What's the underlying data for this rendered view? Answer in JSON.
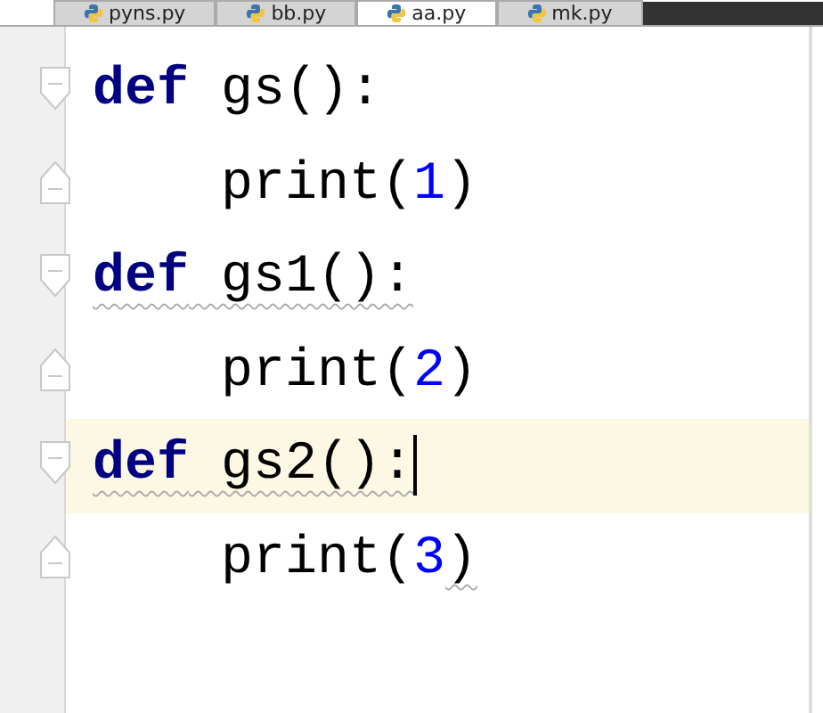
{
  "tabs": [
    {
      "label": "pyns.py",
      "selected": false
    },
    {
      "label": "bb.py",
      "selected": false
    },
    {
      "label": "aa.py",
      "selected": true
    },
    {
      "label": "mk.py",
      "selected": false
    }
  ],
  "lines": [
    {
      "kind": "fold_start",
      "current": false,
      "caret": false,
      "tokens": [
        {
          "kind": "keyword",
          "text": "def",
          "underlined": false
        },
        {
          "kind": "plain",
          "text": " gs():",
          "underlined": false
        }
      ]
    },
    {
      "kind": "fold_end",
      "current": false,
      "caret": false,
      "tokens": [
        {
          "kind": "plain",
          "text": "    print(",
          "underlined": false
        },
        {
          "kind": "number",
          "text": "1",
          "underlined": false
        },
        {
          "kind": "plain",
          "text": ")",
          "underlined": false
        }
      ]
    },
    {
      "kind": "fold_start",
      "current": false,
      "caret": false,
      "tokens": [
        {
          "kind": "keyword",
          "text": "def",
          "underlined": true
        },
        {
          "kind": "plain",
          "text": " gs1():",
          "underlined": true
        }
      ]
    },
    {
      "kind": "fold_end",
      "current": false,
      "caret": false,
      "tokens": [
        {
          "kind": "plain",
          "text": "    print(",
          "underlined": false
        },
        {
          "kind": "number",
          "text": "2",
          "underlined": false
        },
        {
          "kind": "plain",
          "text": ")",
          "underlined": false
        }
      ]
    },
    {
      "kind": "fold_start",
      "current": true,
      "caret": true,
      "tokens": [
        {
          "kind": "keyword",
          "text": "def",
          "underlined": true
        },
        {
          "kind": "plain",
          "text": " gs2():",
          "underlined": true
        }
      ]
    },
    {
      "kind": "fold_end",
      "current": false,
      "caret": false,
      "tokens": [
        {
          "kind": "plain",
          "text": "    print(",
          "underlined": false
        },
        {
          "kind": "number",
          "text": "3",
          "underlined": false
        },
        {
          "kind": "plain",
          "text": ")",
          "underlined": true
        }
      ]
    }
  ]
}
